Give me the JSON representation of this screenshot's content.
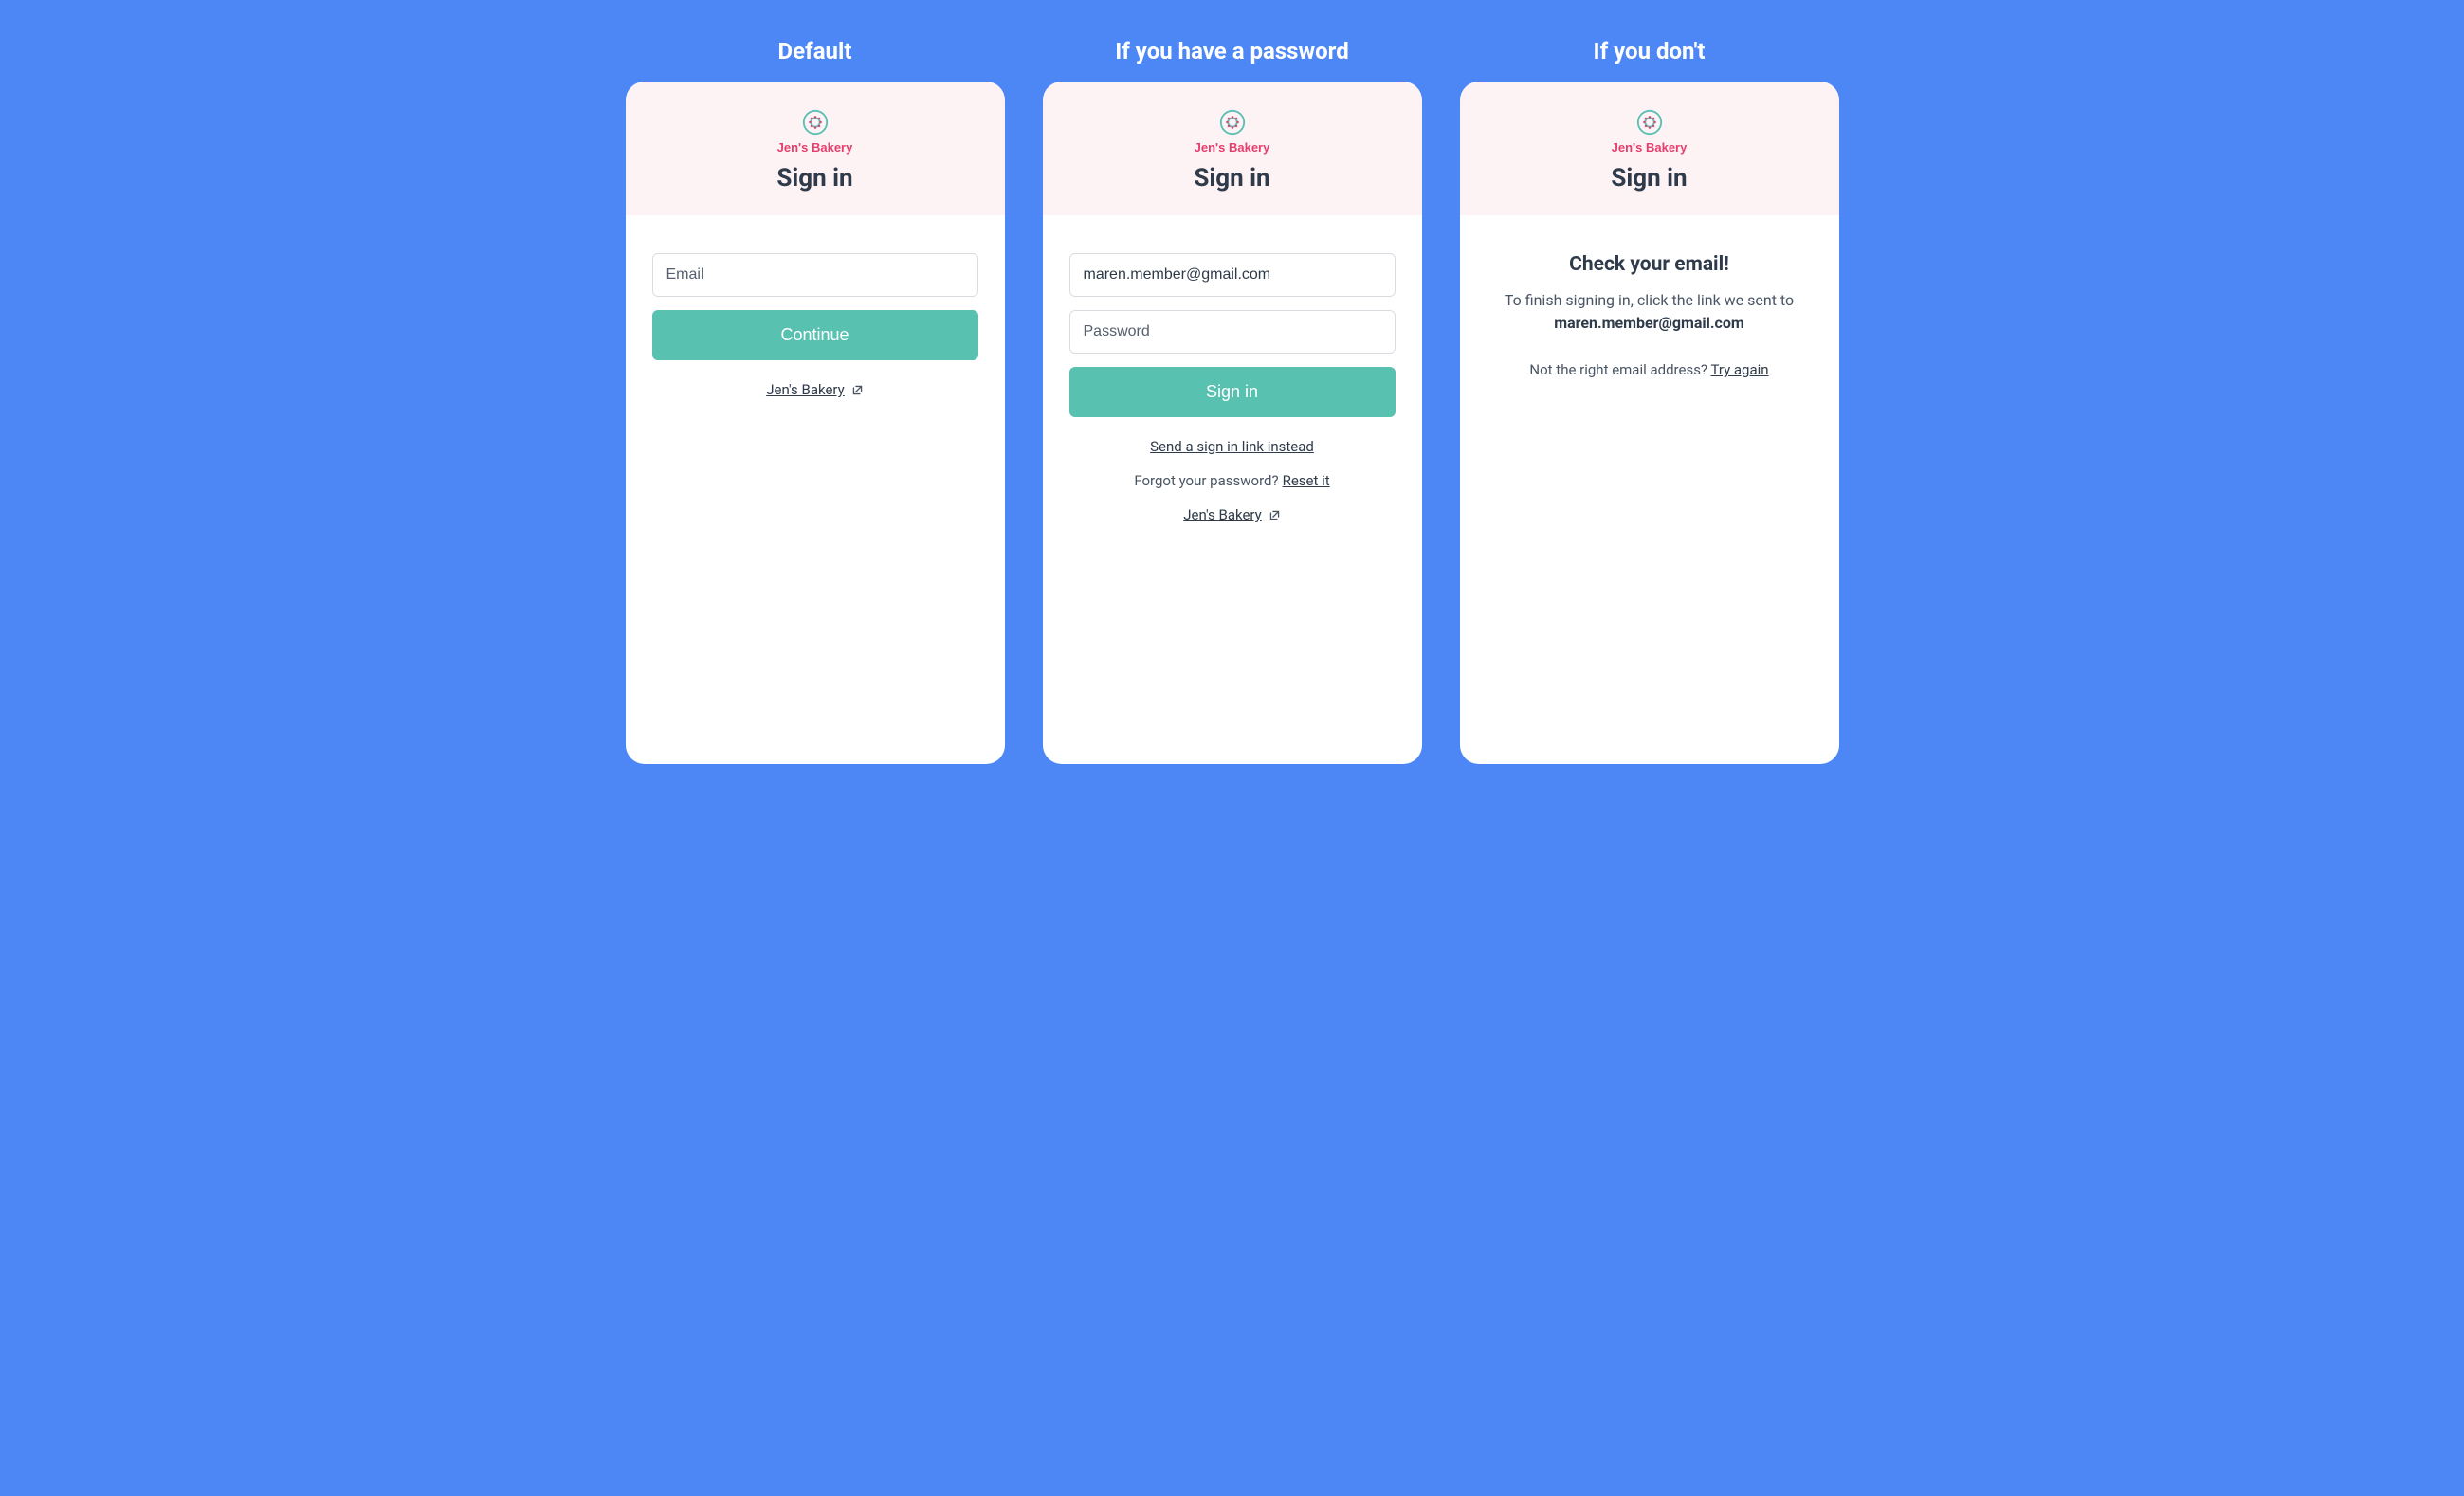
{
  "columns": [
    {
      "title": "Default",
      "logo_text": "Jen's Bakery",
      "heading": "Sign in",
      "email_placeholder": "Email",
      "button_label": "Continue",
      "site_link_text": "Jen's Bakery"
    },
    {
      "title": "If you have a password",
      "logo_text": "Jen's Bakery",
      "heading": "Sign in",
      "email_value": "maren.member@gmail.com",
      "password_placeholder": "Password",
      "button_label": "Sign in",
      "alt_link_text": "Send a sign in link instead",
      "forgot_prefix": "Forgot your password? ",
      "forgot_link": "Reset it",
      "site_link_text": "Jen's Bakery"
    },
    {
      "title": "If you don't",
      "logo_text": "Jen's Bakery",
      "heading": "Sign in",
      "msg_heading": "Check your email!",
      "msg_prefix": "To finish signing in, click the link we sent to ",
      "msg_email": "maren.member@gmail.com",
      "try_prefix": "Not the right email address? ",
      "try_link": "Try again"
    }
  ]
}
